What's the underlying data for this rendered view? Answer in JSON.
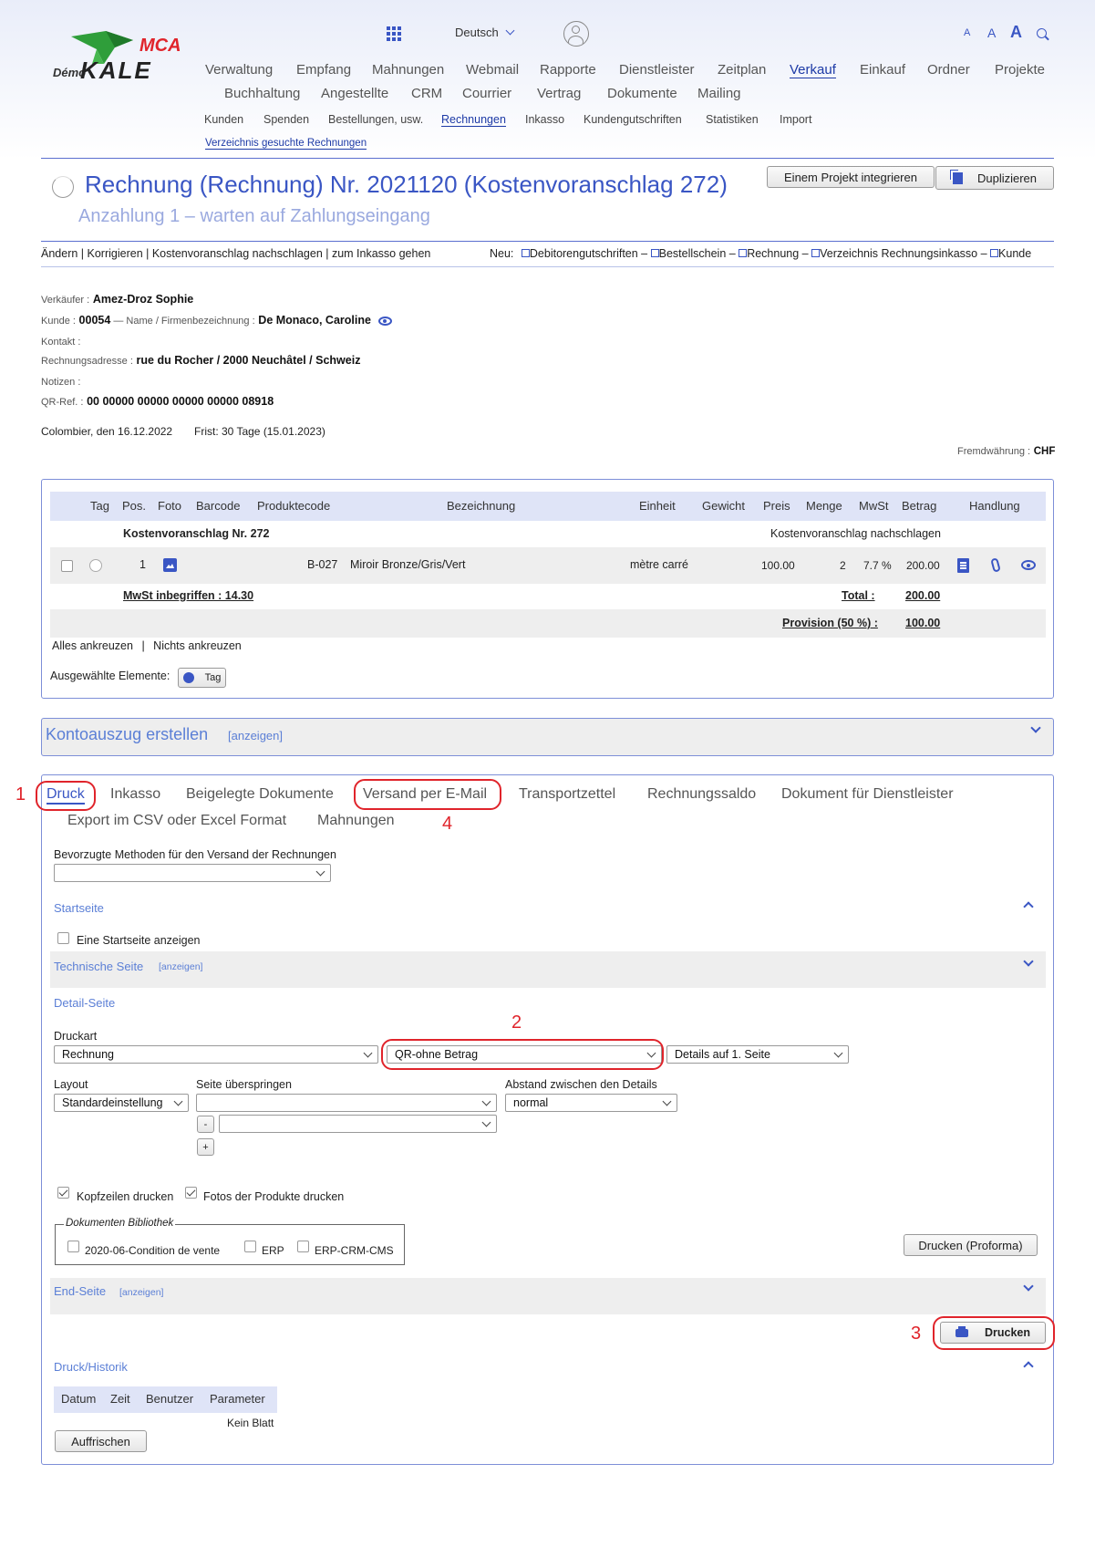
{
  "logo": {
    "demo": "Démo",
    "brand": "KALE",
    "mca": "MCA"
  },
  "language": "Deutsch",
  "font_sizes": [
    "A",
    "A",
    "A"
  ],
  "nav1": [
    "Verwaltung",
    "Empfang",
    "Mahnungen",
    "Webmail",
    "Rapporte",
    "Dienstleister",
    "Zeitplan",
    "Verkauf",
    "Einkauf",
    "Ordner",
    "Projekte"
  ],
  "nav2": [
    "Buchhaltung",
    "Angestellte",
    "CRM",
    "Courrier",
    "Vertrag",
    "Dokumente",
    "Mailing"
  ],
  "nav3": [
    "Kunden",
    "Spenden",
    "Bestellungen, usw.",
    "Rechnungen",
    "Inkasso",
    "Kundengutschriften",
    "Statistiken",
    "Import"
  ],
  "nav4": "Verzeichnis gesuchte Rechnungen",
  "title": "Rechnung (Rechnung) Nr. 2021120 (Kostenvoranschlag 272)",
  "subtitle": "Anzahlung 1 – warten auf Zahlungseingang",
  "btn_project": "Einem Projekt integrieren",
  "btn_duplicate": "Duplizieren",
  "actions_left": "Ändern | Korrigieren | Kostenvoranschlag nachschlagen | zum Inkasso gehen",
  "actions_new_label": "Neu:",
  "actions_new": [
    "Debitorengutschriften –",
    "Bestellschein –",
    "Rechnung –",
    "Verzeichnis Rechnungsinkasso –",
    "Kunde"
  ],
  "meta": {
    "seller_label": "Verkäufer :",
    "seller": "Amez-Droz Sophie",
    "client_label": "Kunde :",
    "client_no": "00054",
    "client_sep": " — Name / Firmenbezeichnung :",
    "client_name": "De Monaco, Caroline",
    "contact_label": "Kontakt :",
    "address_label": "Rechnungsadresse :",
    "address": "rue du Rocher / 2000 Neuchâtel / Schweiz",
    "notes_label": "Notizen :",
    "qr_label": "QR-Ref. :",
    "qr": "00 00000 00000 00000 00000 08918",
    "date": "Colombier, den 16.12.2022",
    "due": "Frist: 30 Tage (15.01.2023)",
    "currency_label": "Fremdwährung :",
    "currency": "CHF"
  },
  "table": {
    "headers": [
      "Tag",
      "Pos.",
      "Foto",
      "Barcode",
      "Produktecode",
      "Bezeichnung",
      "Einheit",
      "Gewicht",
      "Preis",
      "Menge",
      "MwSt",
      "Betrag",
      "Handlung"
    ],
    "group_title": "Kostenvoranschlag Nr. 272",
    "group_link": "Kostenvoranschlag nachschlagen",
    "row": {
      "pos": "1",
      "code": "B-027",
      "name": "Miroir Bronze/Gris/Vert",
      "unit": "mètre carré",
      "price": "100.00",
      "qty": "2",
      "vat": "7.7 %",
      "amount": "200.00"
    },
    "vat_incl": "MwSt inbegriffen : 14.30",
    "total_label": "Total :",
    "total": "200.00",
    "provision_label": "Provision (50 %) :",
    "provision": "100.00",
    "check_all": "Alles ankreuzen",
    "sep": "|",
    "check_none": "Nichts ankreuzen",
    "selected_label": "Ausgewählte Elemente:",
    "tag_btn": "Tag"
  },
  "statement": {
    "title": "Kontoauszug erstellen",
    "show": "[anzeigen]"
  },
  "tabs": [
    "Druck",
    "Inkasso",
    "Beigelegte Dokumente",
    "Versand per E-Mail",
    "Transportzettel",
    "Rechnungssaldo",
    "Dokument für Dienstleister",
    "Export im CSV oder Excel Format",
    "Mahnungen"
  ],
  "annotations": [
    "1",
    "2",
    "3",
    "4"
  ],
  "print": {
    "pref_label": "Bevorzugte Methoden für den Versand der Rechnungen",
    "startpage": "Startseite",
    "startpage_cb": "Eine Startseite anzeigen",
    "techpage": "Technische Seite",
    "show": "[anzeigen]",
    "detailpage": "Detail-Seite",
    "druckart": "Druckart",
    "druckart_val": "Rechnung",
    "qr_val": "QR-ohne Betrag",
    "details_val": "Details auf 1. Seite",
    "layout": "Layout",
    "layout_val": "Standardeinstellung",
    "skip": "Seite überspringen",
    "minus": "-",
    "plus": "+",
    "spacing": "Abstand zwischen den Details",
    "spacing_val": "normal",
    "headers_cb": "Kopfzeilen drucken",
    "photos_cb": "Fotos der Produkte drucken",
    "lib_title": "Dokumenten Bibliothek",
    "lib": [
      "2020-06-Condition de vente",
      "ERP",
      "ERP-CRM-CMS"
    ],
    "proforma": "Drucken (Proforma)",
    "endpage": "End-Seite",
    "print_btn": "Drucken",
    "history": "Druck/Historik",
    "hist_headers": [
      "Datum",
      "Zeit",
      "Benutzer",
      "Parameter"
    ],
    "no_sheet": "Kein Blatt",
    "refresh": "Auffrischen"
  },
  "colors": {
    "accent": "#3a56c4",
    "highlight": "#e0242b",
    "header_bg": "#dfe4f7"
  }
}
